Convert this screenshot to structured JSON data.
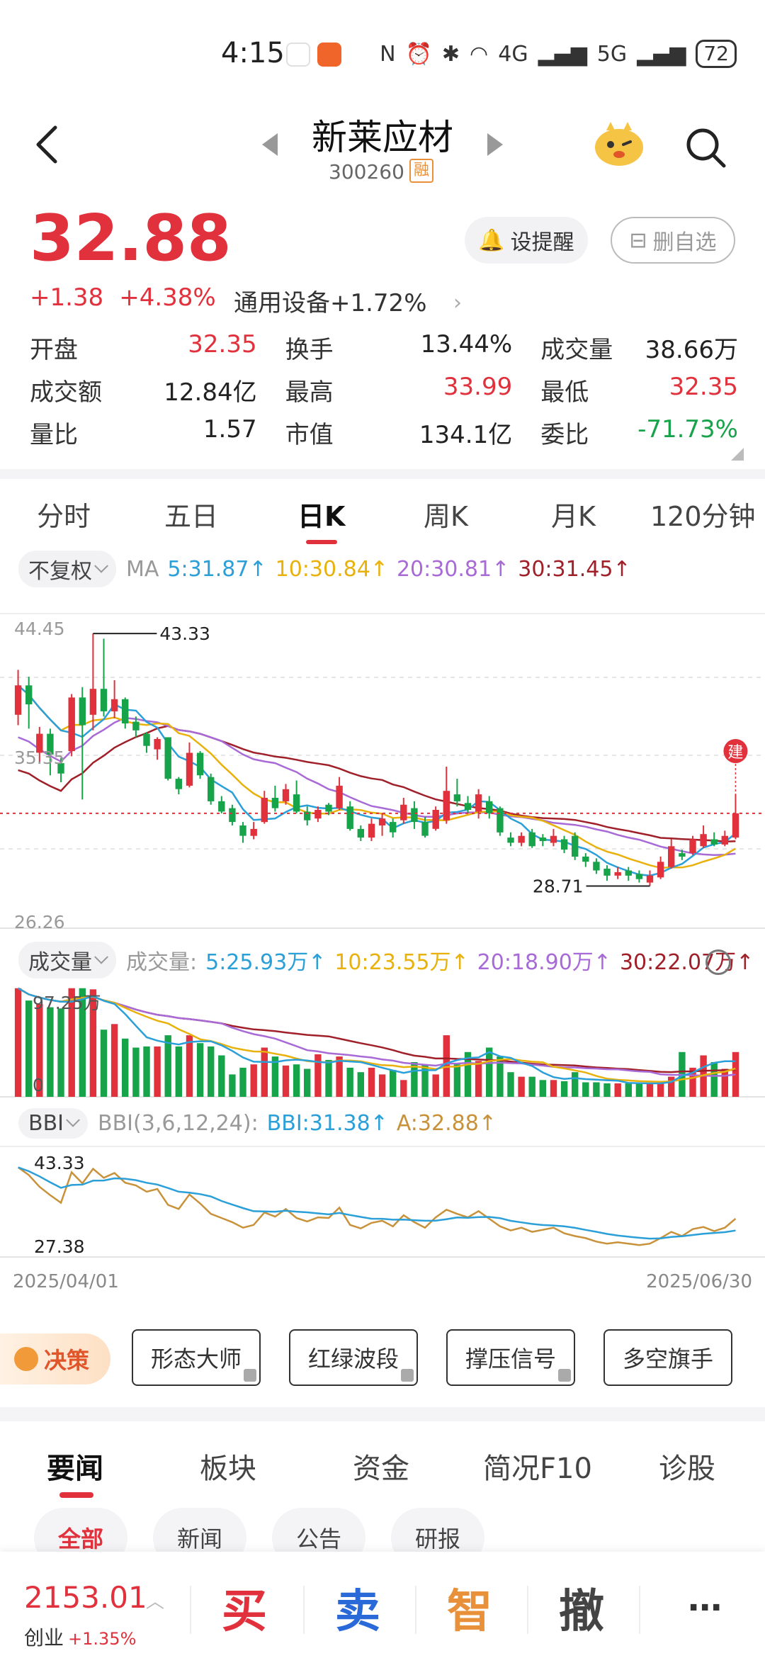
{
  "status": {
    "time": "4:15",
    "network_4g": "4G",
    "network_5g": "5G",
    "battery": "72"
  },
  "header": {
    "stock_name": "新莱应材",
    "stock_code": "300260",
    "margin_badge": "融"
  },
  "quote": {
    "price": "32.88",
    "change": "+1.38",
    "change_pct": "+4.38%",
    "sector_name": "通用设备",
    "sector_pct": "+1.72%",
    "alert_label": "设提醒",
    "remove_fav_label": "删自选",
    "rows": [
      [
        {
          "label": "开盘",
          "value": "32.35",
          "tone": "red"
        },
        {
          "label": "换手",
          "value": "13.44%",
          "tone": ""
        },
        {
          "label": "成交量",
          "value": "38.66万",
          "tone": ""
        }
      ],
      [
        {
          "label": "成交额",
          "value": "12.84亿",
          "tone": ""
        },
        {
          "label": "最高",
          "value": "33.99",
          "tone": "red"
        },
        {
          "label": "最低",
          "value": "32.35",
          "tone": "red"
        }
      ],
      [
        {
          "label": "量比",
          "value": "1.57",
          "tone": ""
        },
        {
          "label": "市值",
          "value": "134.1亿",
          "tone": ""
        },
        {
          "label": "委比",
          "value": "-71.73%",
          "tone": "green"
        }
      ]
    ]
  },
  "kline_tabs": [
    "分时",
    "五日",
    "日K",
    "周K",
    "月K",
    "120分钟"
  ],
  "kline_active_tab": "日K",
  "ma_row": {
    "adjust_label": "不复权",
    "ma_label": "MA",
    "ma5": "5:31.87↑",
    "ma10": "10:30.84↑",
    "ma20": "20:30.81↑",
    "ma30": "30:31.45↑"
  },
  "volume_row": {
    "label": "成交量",
    "prefix": "成交量:",
    "v5": "5:25.93万↑",
    "v10": "10:23.55万↑",
    "v20": "20:18.90万↑",
    "v30": "30:22.07万↑"
  },
  "bbi_row": {
    "label": "BBI",
    "params": "BBI(3,6,12,24):",
    "bbi": "BBI:31.38↑",
    "a": "A:32.88↑"
  },
  "decision": {
    "tag": "决策",
    "buttons": [
      "形态大师",
      "红绿波段",
      "撑压信号",
      "多空旗手"
    ]
  },
  "news_tabs": [
    "要闻",
    "板块",
    "资金",
    "简况F10",
    "诊股"
  ],
  "news_active_tab": "要闻",
  "news_chips": [
    "全部",
    "新闻",
    "公告",
    "研报"
  ],
  "bottom": {
    "index_value": "2153.01",
    "index_name": "创业",
    "index_pct": "+1.35%",
    "buy": "买",
    "sell": "卖",
    "smart": "智",
    "cancel": "撤",
    "more": "⋯"
  },
  "colors": {
    "up": "#e0313c",
    "down": "#17a34a",
    "ma5": "#2a9fd8",
    "ma10": "#e8b10c",
    "ma20": "#a86ad6",
    "ma30": "#a0202a",
    "bbi_a": "#c8923a"
  },
  "chart_data": {
    "type": "candlestick",
    "title": "",
    "y_max_label": "44.45",
    "y_min_label": "26.26",
    "y_mid_label": "35.35",
    "ylim": [
      26.26,
      44.45
    ],
    "high_marker": "43.33",
    "low_marker": "28.71",
    "build_marker": "建",
    "x_start": "2025/04/01",
    "x_end": "2025/06/30",
    "candles": [
      [
        38.6,
        40.3,
        41.2,
        38.0
      ],
      [
        40.3,
        39.2,
        40.8,
        37.8
      ],
      [
        36.4,
        37.5,
        37.9,
        35.8
      ],
      [
        37.5,
        36.3,
        37.8,
        35.1
      ],
      [
        35.8,
        35.2,
        36.1,
        34.7
      ],
      [
        36.5,
        39.6,
        39.8,
        36.2
      ],
      [
        39.6,
        38.0,
        40.2,
        33.7
      ],
      [
        38.6,
        40.1,
        43.3,
        37.7
      ],
      [
        40.1,
        38.8,
        43.0,
        38.5
      ],
      [
        38.8,
        39.5,
        40.6,
        38.4
      ],
      [
        39.5,
        38.1,
        39.6,
        37.8
      ],
      [
        38.2,
        37.7,
        38.5,
        37.3
      ],
      [
        37.5,
        36.8,
        37.6,
        36.4
      ],
      [
        36.6,
        37.2,
        37.3,
        36.0
      ],
      [
        37.3,
        34.9,
        37.3,
        34.8
      ],
      [
        34.9,
        34.3,
        35.0,
        34.0
      ],
      [
        34.5,
        36.4,
        37.0,
        34.4
      ],
      [
        36.4,
        35.1,
        36.5,
        34.9
      ],
      [
        35.0,
        33.6,
        35.2,
        33.4
      ],
      [
        33.6,
        33.0,
        33.9,
        32.9
      ],
      [
        33.2,
        32.4,
        33.4,
        32.2
      ],
      [
        32.2,
        31.6,
        32.4,
        31.2
      ],
      [
        31.6,
        32.0,
        32.4,
        31.4
      ],
      [
        32.4,
        33.8,
        34.2,
        32.3
      ],
      [
        33.8,
        33.2,
        34.5,
        33.0
      ],
      [
        33.6,
        34.3,
        34.6,
        33.4
      ],
      [
        34.0,
        33.0,
        34.8,
        32.9
      ],
      [
        33.0,
        32.5,
        33.3,
        32.2
      ],
      [
        32.6,
        33.1,
        33.3,
        32.4
      ],
      [
        33.4,
        33.0,
        33.5,
        32.8
      ],
      [
        33.2,
        34.5,
        35.0,
        33.1
      ],
      [
        33.3,
        32.0,
        33.6,
        31.9
      ],
      [
        32.0,
        31.5,
        32.2,
        31.3
      ],
      [
        31.5,
        32.3,
        32.6,
        31.3
      ],
      [
        32.2,
        32.6,
        32.9,
        31.6
      ],
      [
        32.4,
        31.8,
        32.6,
        31.5
      ],
      [
        32.5,
        33.4,
        33.8,
        32.3
      ],
      [
        33.2,
        32.4,
        33.6,
        32.0
      ],
      [
        32.4,
        31.6,
        32.7,
        31.5
      ],
      [
        32.0,
        33.1,
        33.3,
        31.9
      ],
      [
        32.5,
        34.2,
        35.6,
        32.3
      ],
      [
        34.0,
        33.6,
        34.9,
        33.3
      ],
      [
        33.5,
        33.1,
        33.9,
        32.9
      ],
      [
        33.0,
        34.0,
        34.3,
        32.6
      ],
      [
        33.6,
        32.9,
        33.9,
        32.6
      ],
      [
        33.2,
        31.8,
        33.3,
        31.6
      ],
      [
        31.5,
        31.2,
        31.8,
        31.0
      ],
      [
        31.2,
        31.6,
        31.8,
        31.0
      ],
      [
        31.8,
        31.0,
        32.0,
        30.9
      ],
      [
        31.5,
        31.3,
        31.7,
        31.0
      ],
      [
        31.2,
        31.6,
        32.0,
        31.0
      ],
      [
        31.4,
        30.8,
        31.6,
        30.6
      ],
      [
        31.6,
        30.4,
        31.8,
        30.2
      ],
      [
        30.4,
        30.1,
        30.6,
        29.8
      ],
      [
        30.1,
        29.6,
        30.3,
        29.4
      ],
      [
        29.7,
        29.3,
        29.9,
        29.0
      ],
      [
        29.3,
        29.5,
        29.8,
        29.1
      ],
      [
        29.6,
        29.3,
        29.8,
        29.0
      ],
      [
        29.4,
        29.1,
        29.6,
        28.9
      ],
      [
        28.9,
        29.3,
        29.6,
        28.7
      ],
      [
        29.2,
        30.1,
        30.4,
        29.1
      ],
      [
        29.8,
        31.0,
        31.4,
        29.7
      ],
      [
        30.6,
        30.4,
        30.8,
        30.2
      ],
      [
        30.6,
        31.4,
        31.6,
        30.5
      ],
      [
        31.0,
        31.7,
        32.2,
        30.9
      ],
      [
        31.4,
        31.1,
        31.8,
        31.0
      ],
      [
        31.1,
        31.6,
        31.9,
        31.0
      ],
      [
        31.5,
        32.9,
        34.0,
        31.4
      ]
    ],
    "volumes": [
      9.7,
      8.6,
      8.3,
      8.0,
      7.9,
      9.7,
      9.7,
      9.6,
      6.0,
      6.5,
      5.2,
      4.4,
      4.5,
      4.5,
      5.5,
      4.5,
      5.5,
      4.8,
      4.5,
      3.7,
      2.0,
      2.6,
      2.9,
      4.4,
      3.6,
      2.8,
      2.9,
      2.5,
      3.8,
      3.3,
      3.6,
      2.6,
      2.2,
      2.6,
      2.0,
      2.4,
      1.5,
      3.1,
      2.9,
      2.0,
      5.5,
      2.9,
      4.0,
      3.2,
      4.4,
      3.6,
      2.2,
      1.8,
      1.8,
      1.5,
      1.5,
      1.4,
      2.2,
      1.3,
      1.3,
      1.2,
      1.2,
      1.2,
      1.2,
      1.2,
      1.2,
      1.8,
      4.0,
      2.6,
      3.7,
      3.1,
      2.5,
      4.0
    ],
    "volume_max_label": "97.25万",
    "volume_zero_label": "0",
    "bbi_max_label": "43.33",
    "bbi_min_label": "27.38"
  }
}
